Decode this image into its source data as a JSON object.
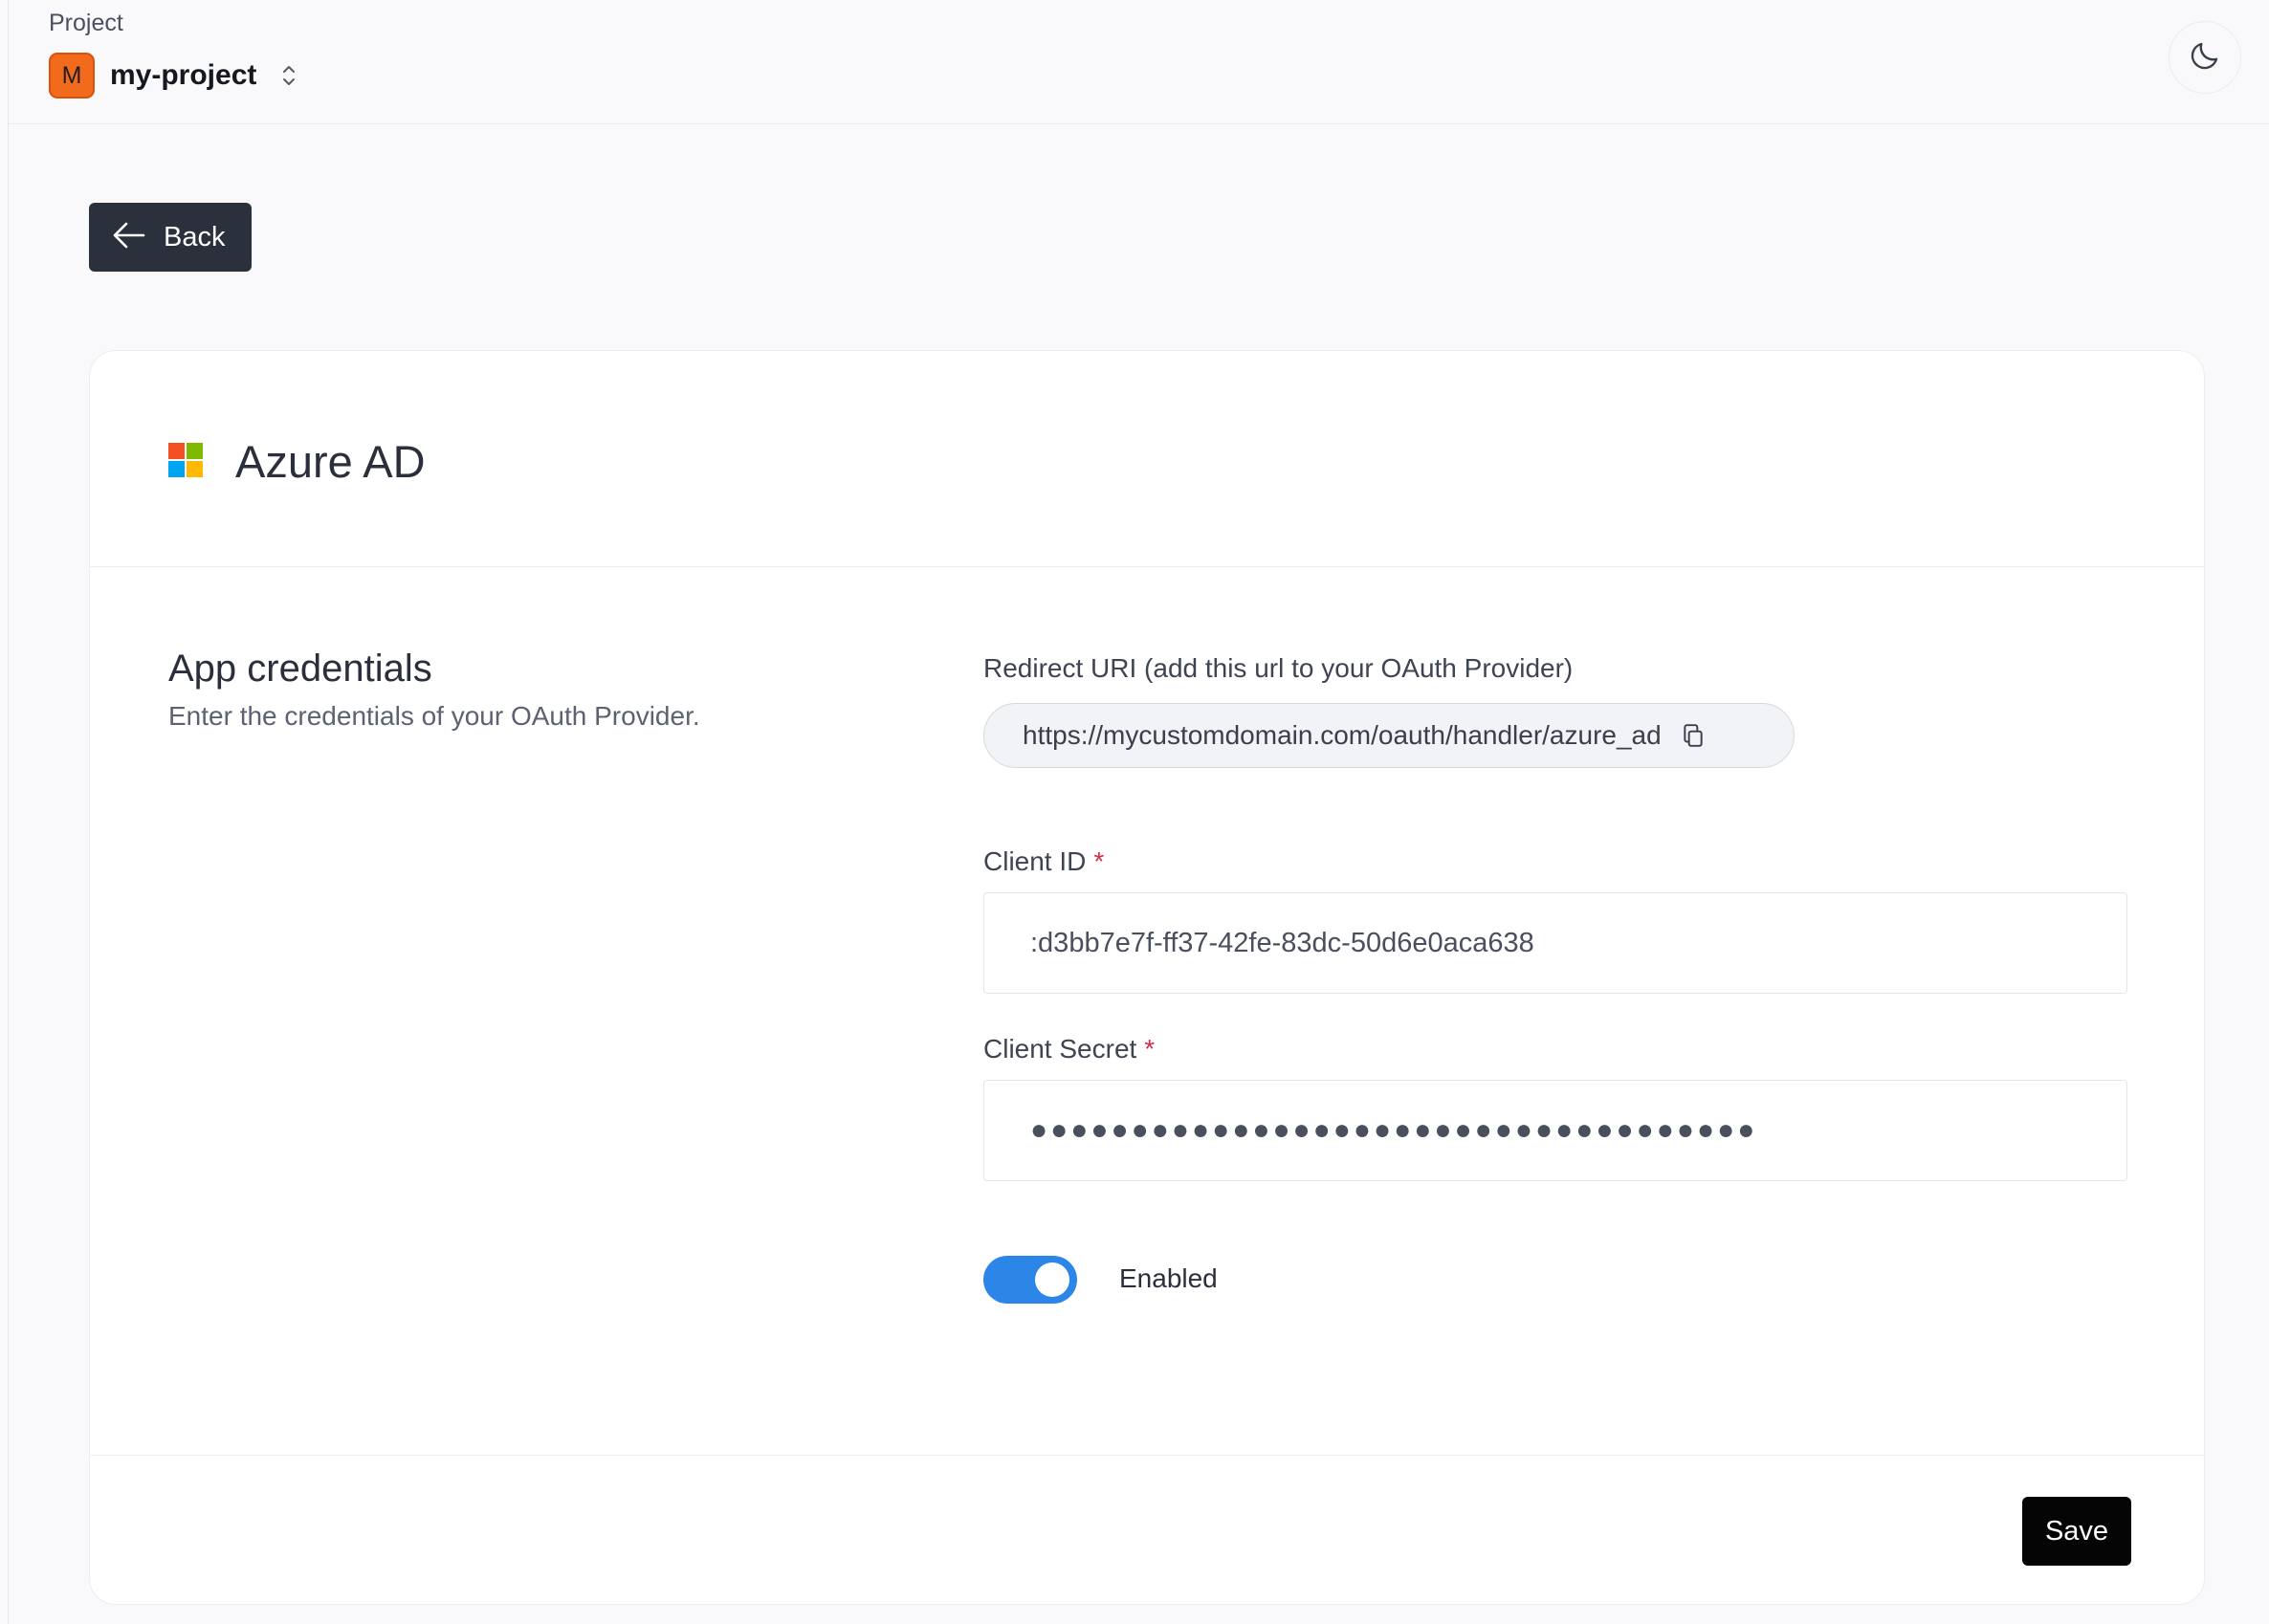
{
  "header": {
    "project_label": "Project",
    "project_initial": "M",
    "project_name": "my-project",
    "switcher_icon": "chevron-up-down-icon",
    "theme_icon": "moon-icon"
  },
  "back": {
    "label": "Back",
    "icon": "arrow-left-icon"
  },
  "provider": {
    "name": "Azure AD",
    "logo": "microsoft-logo",
    "logo_colors": [
      "#f25022",
      "#7fba00",
      "#00a4ef",
      "#ffb900"
    ]
  },
  "section": {
    "title": "App credentials",
    "description": "Enter the credentials of your OAuth Provider."
  },
  "redirect": {
    "label": "Redirect URI (add this url to your OAuth Provider)",
    "value": "https://mycustomdomain.com/oauth/handler/azure_ad",
    "copy_icon": "copy-icon"
  },
  "client_id": {
    "label": "Client ID",
    "required_mark": "*",
    "value": ":d3bb7e7f-ff37-42fe-83dc-50d6e0aca638"
  },
  "client_secret": {
    "label": "Client Secret",
    "required_mark": "*",
    "value": "●●●●●●●●●●●●●●●●●●●●●●●●●●●●●●●●●●●●"
  },
  "enabled": {
    "label": "Enabled",
    "state": true,
    "color": "#2b86e8"
  },
  "footer": {
    "save_label": "Save"
  }
}
